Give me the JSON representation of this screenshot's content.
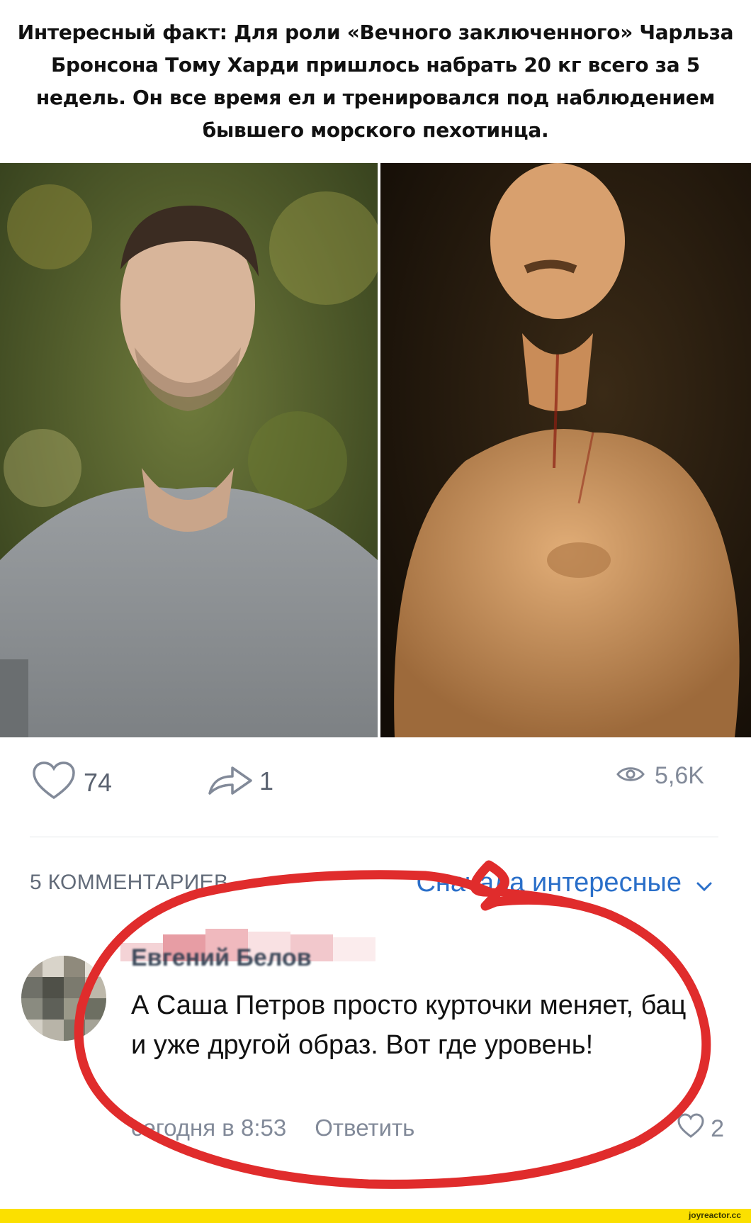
{
  "post": {
    "text": "Интересный факт: Для роли «Вечного заключенного» Чарльза Бронсона Тому Харди пришлось набрать 20 кг всего за 5 недель. Он все время ел и тренировался под наблюдением бывшего морского пехотинца."
  },
  "actions": {
    "likes": "74",
    "shares": "1",
    "views": "5,6K"
  },
  "comments": {
    "count_label": "5 КОММЕНТАРИЕВ",
    "sort_label": "Сначала интересные",
    "items": [
      {
        "author": "Евгений Белов",
        "text": "А Саша Петров просто курточки меняет, бац и уже другой образ. Вот где уровень!",
        "time": "сегодня в 8:53",
        "reply_label": "Ответить",
        "likes": "2"
      }
    ]
  },
  "footer": {
    "watermark": "joyreactor.cc"
  },
  "colors": {
    "accent": "#2a6fc9",
    "muted": "#828a99",
    "annotation": "#e02c2c",
    "footer": "#fbe000"
  },
  "icons": [
    "heart-icon",
    "share-arrow-icon",
    "eye-icon",
    "chevron-down-icon",
    "comment-heart-icon"
  ]
}
